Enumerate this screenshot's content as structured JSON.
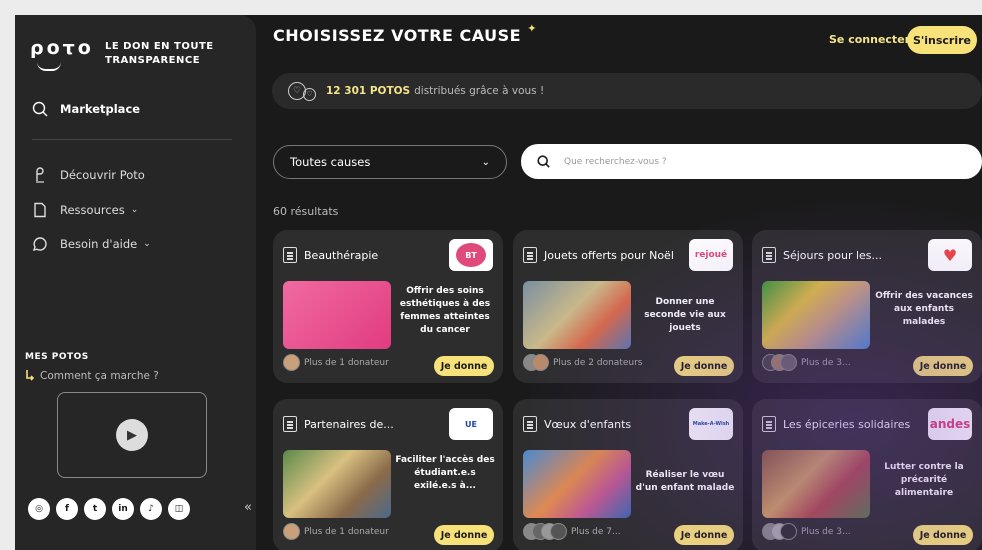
{
  "sidebar": {
    "logo": "ρoτo",
    "tagline_1": "LE DON EN TOUTE",
    "tagline_2": "TRANSPARENCE",
    "marketplace": "Marketplace",
    "discover": "Découvrir Poto",
    "resources": "Ressources",
    "help": "Besoin d'aide",
    "mes_potos": "MES POTOS",
    "how_it_works": "Comment ça marche ?",
    "socials": [
      "instagram-icon",
      "facebook-icon",
      "twitter-icon",
      "linkedin-icon",
      "tiktok-icon",
      "twitch-icon"
    ]
  },
  "header": {
    "title": "CHOISISSEZ VOTRE CAUSE",
    "login": "Se connecter",
    "signup": "S'inscrire"
  },
  "banner": {
    "count": "12 301 POTOS",
    "text": "distribués grâce à vous !"
  },
  "filters": {
    "select": "Toutes causes",
    "search_placeholder": "Que recherchez-vous ?"
  },
  "results": "60 résultats",
  "give_label": "Je donne",
  "cards": [
    {
      "title": "Beauthérapie",
      "desc": "Offrir des soins esthétiques à des femmes atteintes du cancer",
      "donors": "Plus de 1 donateur",
      "org": "BT"
    },
    {
      "title": "Jouets offerts pour Noël",
      "desc": "Donner une seconde vie aux jouets",
      "donors": "Plus de 2 donateurs",
      "org": "rejoué"
    },
    {
      "title": "Séjours pour les...",
      "desc": "Offrir des vacances aux enfants malades",
      "donors": "Plus de 3...",
      "org": "♥"
    },
    {
      "title": "Partenaires de...",
      "desc": "Faciliter l'accès des étudiant.e.s exilé.e.s à...",
      "donors": "Plus de 1 donateur",
      "org": "UE"
    },
    {
      "title": "Vœux d'enfants",
      "desc": "Réaliser le vœu d'un enfant malade",
      "donors": "Plus de 7...",
      "org": "Make-A-Wish"
    },
    {
      "title": "Les épiceries solidaires",
      "desc": "Lutter contre la précarité alimentaire",
      "donors": "Plus de 3...",
      "org": "andes"
    }
  ],
  "colors": {
    "accent": "#f7e27a",
    "background": "#1a1a1a",
    "sidebar": "#262626",
    "card": "#2d2d2d"
  }
}
